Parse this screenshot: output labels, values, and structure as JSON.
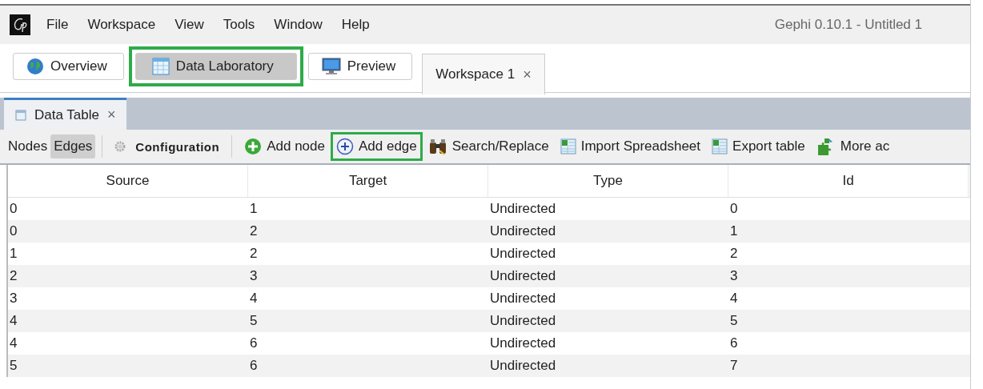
{
  "window": {
    "title": "Gephi 0.10.1 - Untitled 1"
  },
  "menu": [
    "File",
    "Workspace",
    "View",
    "Tools",
    "Window",
    "Help"
  ],
  "perspectives": [
    {
      "label": "Overview",
      "kind": "globe",
      "selected": false,
      "highlighted": false
    },
    {
      "label": "Data Laboratory",
      "kind": "table",
      "selected": true,
      "highlighted": true
    },
    {
      "label": "Preview",
      "kind": "monitor",
      "selected": false,
      "highlighted": false
    }
  ],
  "workspace_tabs": [
    {
      "label": "Workspace 1",
      "close": "×",
      "selected": true
    }
  ],
  "panel_tabs": [
    {
      "label": "Data Table",
      "close": "×",
      "selected": true
    }
  ],
  "view_toggle": [
    {
      "label": "Nodes",
      "selected": false
    },
    {
      "label": "Edges",
      "selected": true
    }
  ],
  "toolbar": [
    {
      "kind": "gear",
      "label": "Configuration",
      "highlighted": false
    },
    {
      "kind": "add-node",
      "label": "Add node",
      "highlighted": false
    },
    {
      "kind": "add-edge",
      "label": "Add edge",
      "highlighted": true
    },
    {
      "kind": "binoculars",
      "label": "Search/Replace",
      "highlighted": false
    },
    {
      "kind": "sheet",
      "label": "Import Spreadsheet",
      "highlighted": false
    },
    {
      "kind": "sheet",
      "label": "Export table",
      "highlighted": false
    },
    {
      "kind": "puzzle",
      "label": "More ac",
      "highlighted": false
    }
  ],
  "table": {
    "columns": [
      "Source",
      "Target",
      "Type",
      "Id"
    ],
    "rows": [
      [
        "0",
        "1",
        "Undirected",
        "0"
      ],
      [
        "0",
        "2",
        "Undirected",
        "1"
      ],
      [
        "1",
        "2",
        "Undirected",
        "2"
      ],
      [
        "2",
        "3",
        "Undirected",
        "3"
      ],
      [
        "3",
        "4",
        "Undirected",
        "4"
      ],
      [
        "4",
        "5",
        "Undirected",
        "5"
      ],
      [
        "4",
        "6",
        "Undirected",
        "6"
      ],
      [
        "5",
        "6",
        "Undirected",
        "7"
      ]
    ]
  }
}
